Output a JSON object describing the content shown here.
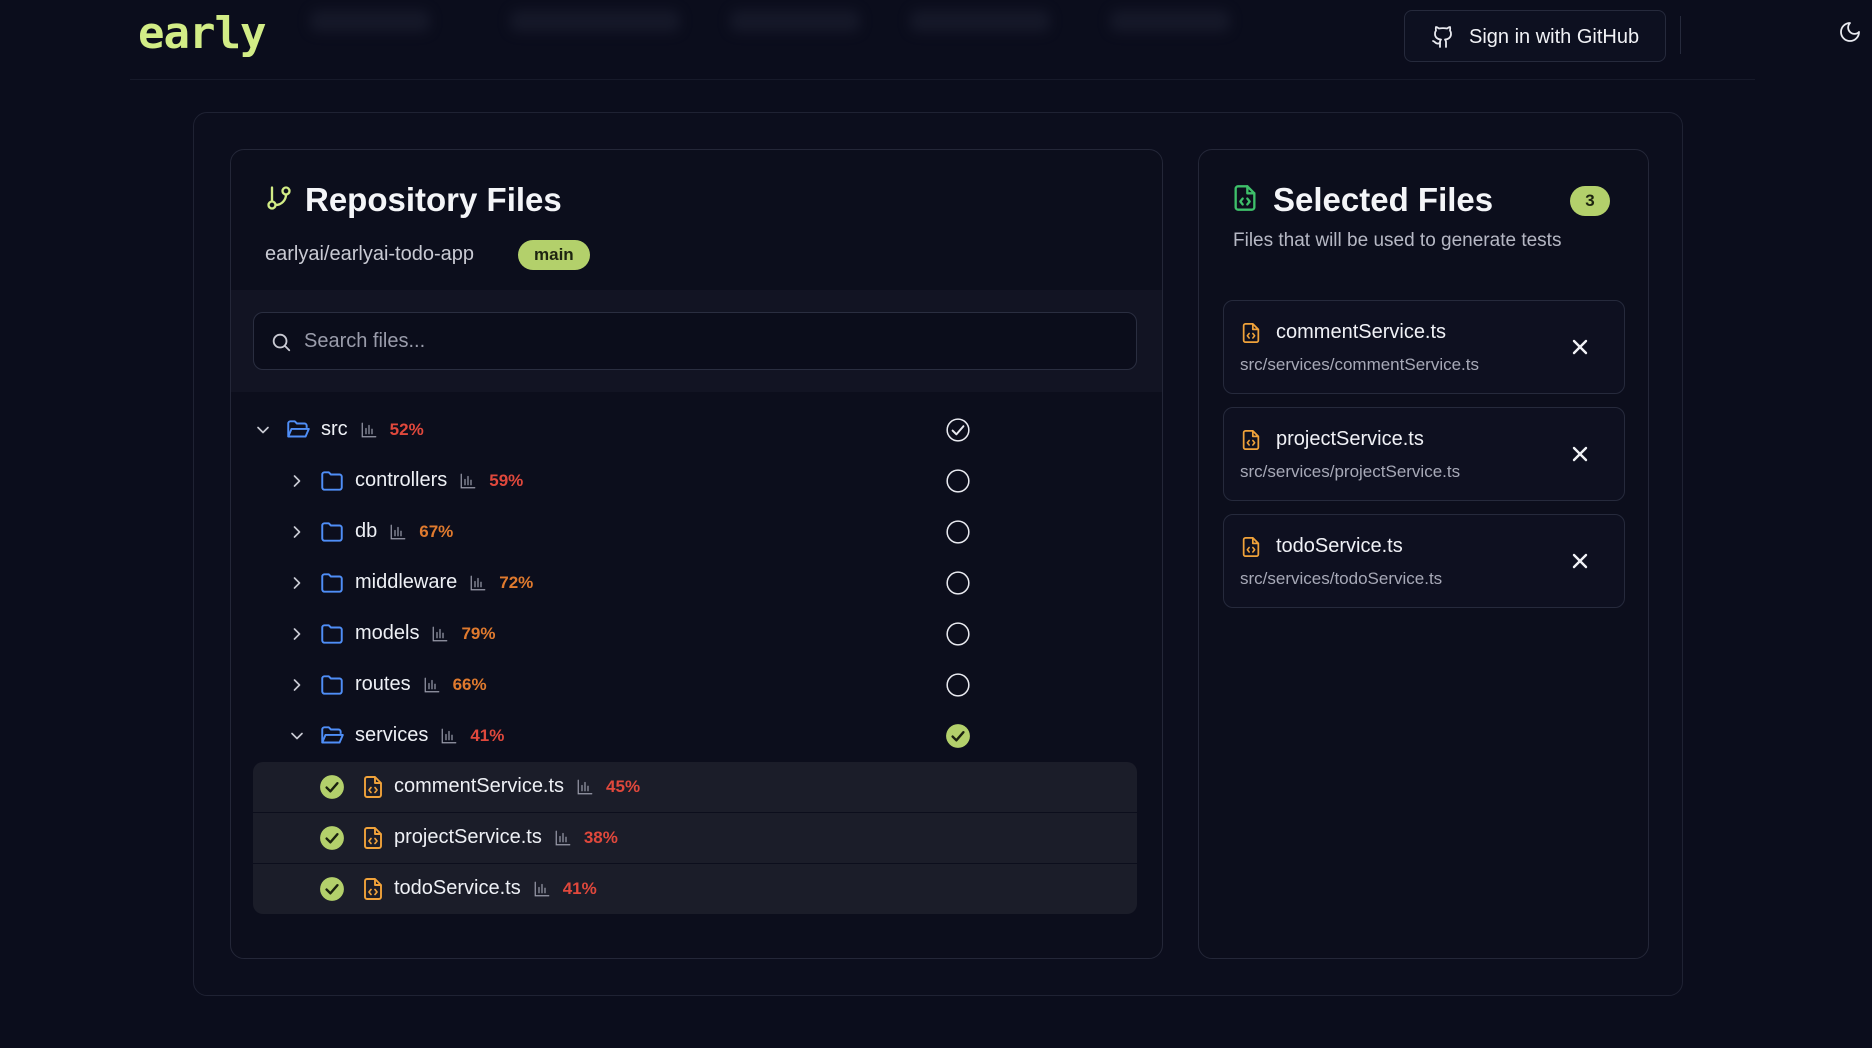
{
  "header": {
    "logo": "early",
    "sign_in_label": "Sign in with GitHub"
  },
  "repo_panel": {
    "title": "Repository Files",
    "repo_name": "earlyai/earlyai-todo-app",
    "branch": "main",
    "search_placeholder": "Search files..."
  },
  "tree": [
    {
      "name": "src",
      "pct": "52%",
      "pct_color": "#e0483c",
      "level": 0,
      "expanded": true,
      "type": "folder",
      "state": "partial"
    },
    {
      "name": "controllers",
      "pct": "59%",
      "pct_color": "#e0483c",
      "level": 1,
      "expanded": false,
      "type": "folder",
      "state": "none"
    },
    {
      "name": "db",
      "pct": "67%",
      "pct_color": "#e07a2e",
      "level": 1,
      "expanded": false,
      "type": "folder",
      "state": "none"
    },
    {
      "name": "middleware",
      "pct": "72%",
      "pct_color": "#e07a2e",
      "level": 1,
      "expanded": false,
      "type": "folder",
      "state": "none"
    },
    {
      "name": "models",
      "pct": "79%",
      "pct_color": "#e07a2e",
      "level": 1,
      "expanded": false,
      "type": "folder",
      "state": "none"
    },
    {
      "name": "routes",
      "pct": "66%",
      "pct_color": "#e07a2e",
      "level": 1,
      "expanded": false,
      "type": "folder",
      "state": "none"
    },
    {
      "name": "services",
      "pct": "41%",
      "pct_color": "#e0483c",
      "level": 1,
      "expanded": true,
      "type": "folder",
      "state": "full"
    },
    {
      "name": "commentService.ts",
      "pct": "45%",
      "pct_color": "#e0483c",
      "level": 2,
      "type": "file",
      "state": "selected"
    },
    {
      "name": "projectService.ts",
      "pct": "38%",
      "pct_color": "#e0483c",
      "level": 2,
      "type": "file",
      "state": "selected"
    },
    {
      "name": "todoService.ts",
      "pct": "41%",
      "pct_color": "#e0483c",
      "level": 2,
      "type": "file",
      "state": "selected"
    }
  ],
  "selected_panel": {
    "title": "Selected Files",
    "count": "3",
    "subtitle": "Files that will be used to generate tests",
    "files": [
      {
        "name": "commentService.ts",
        "path": "src/services/commentService.ts"
      },
      {
        "name": "projectService.ts",
        "path": "src/services/projectService.ts"
      },
      {
        "name": "todoService.ts",
        "path": "src/services/todoService.ts"
      }
    ]
  },
  "colors": {
    "accent_green": "#b3d06b",
    "folder_blue": "#4f8ef7",
    "file_orange": "#f0a23a",
    "selected_file_icon_green": "#3ec06a"
  }
}
